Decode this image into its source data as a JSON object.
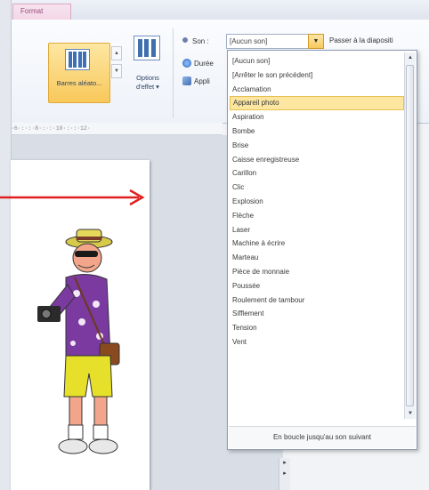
{
  "ribbon": {
    "tab_format": "Format",
    "effect_button_label": "Barres aléato...",
    "options_label_line1": "Options",
    "options_label_line2": "d'effet ▾",
    "sound_label": "Son :",
    "sound_value": "[Aucun son]",
    "next_slide_label": "Passer à la diapositi",
    "duration_label": "Durée",
    "apply_label": "Appli"
  },
  "ruler": {
    "text": "·6·:·:·8·:·:·10·:·:·12·"
  },
  "dropdown": {
    "items": [
      "[Aucun son]",
      "[Arrêter le son précédent]",
      "Acclamation",
      "Appareil photo",
      "Aspiration",
      "Bombe",
      "Brise",
      "Caisse enregistreuse",
      "Carillon",
      "Clic",
      "Explosion",
      "Flèche",
      "Laser",
      "Machine à écrire",
      "Marteau",
      "Pièce de monnaie",
      "Poussée",
      "Roulement de tambour",
      "Sifflement",
      "Tension",
      "Vent"
    ],
    "selected_index": 3,
    "loop_label": "En boucle jusqu'au son suivant"
  },
  "colors": {
    "accent": "#f8c85a",
    "arrow": "#e02020",
    "selection": "#fce6a0"
  }
}
